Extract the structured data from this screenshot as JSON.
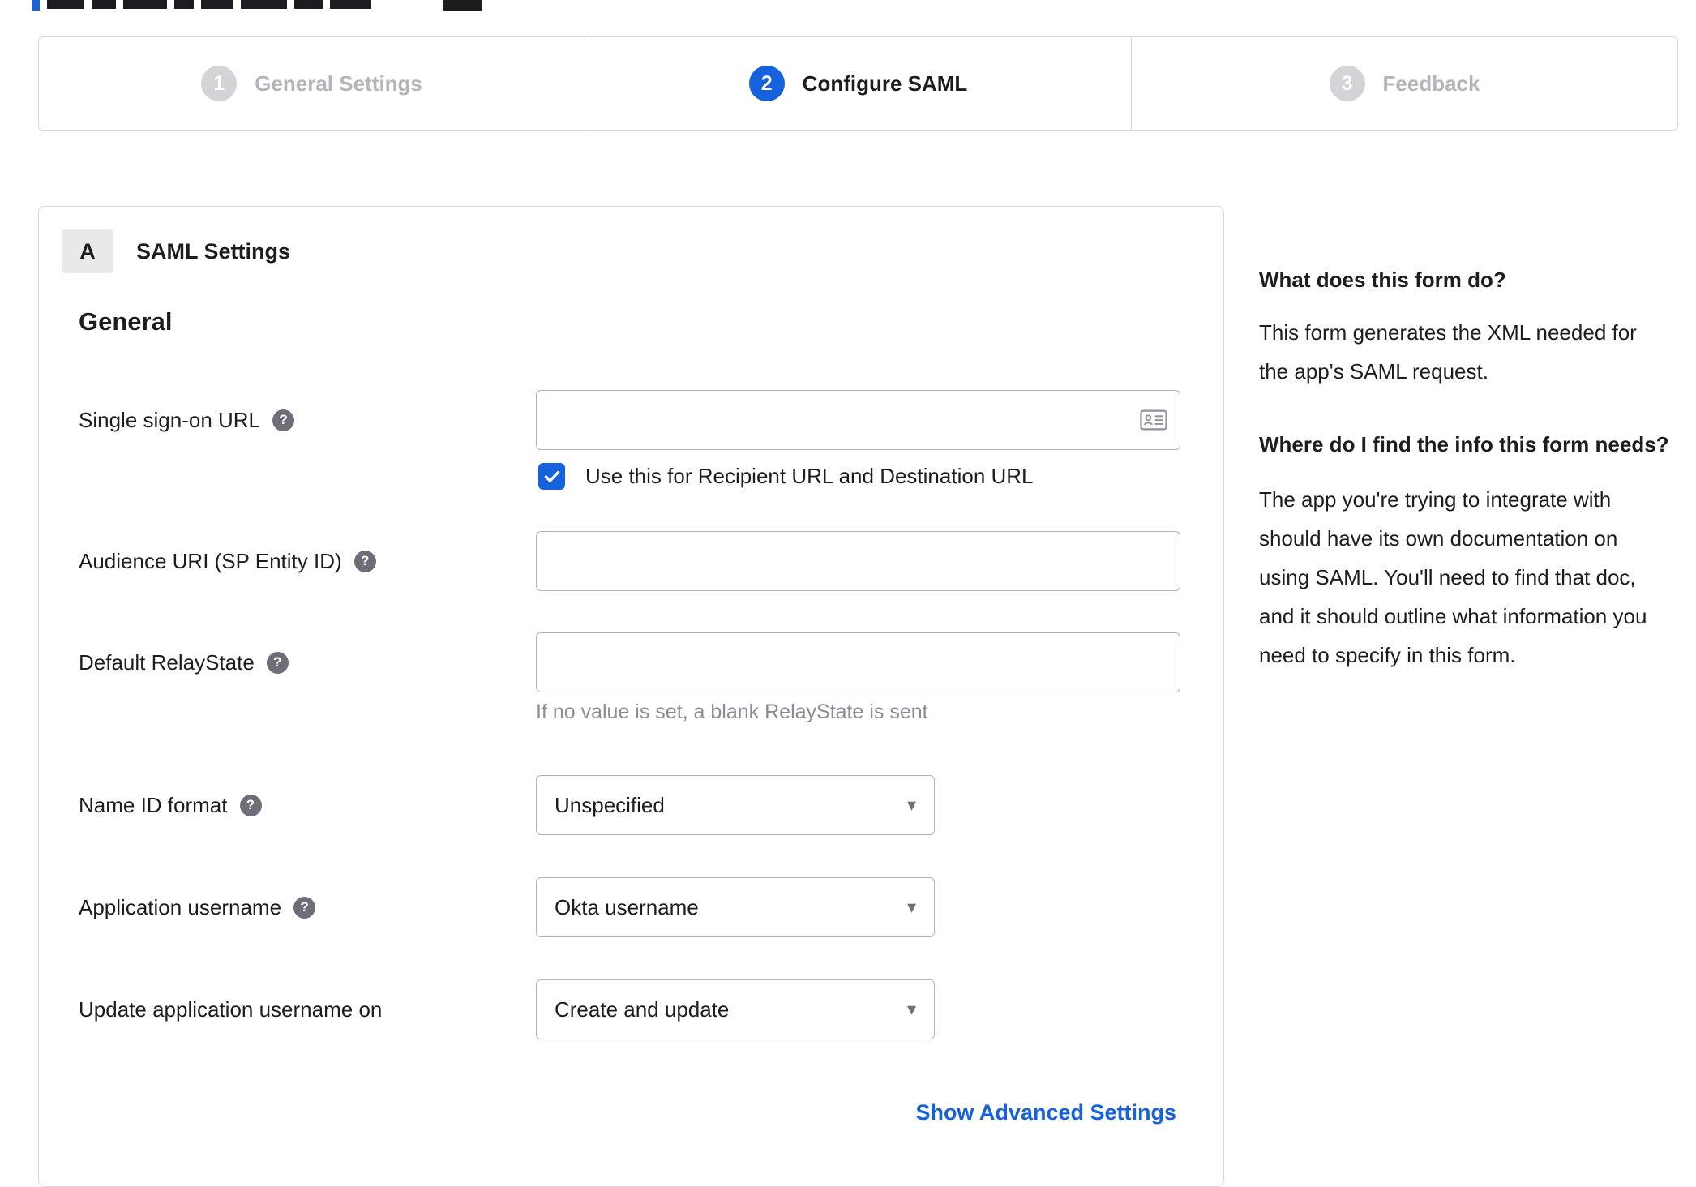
{
  "icons": {
    "help": "?",
    "dropdown": "▾"
  },
  "colors": {
    "accent": "#1662dd"
  },
  "stepper": {
    "active_step": "2",
    "steps": [
      {
        "number": "1",
        "label": "General Settings"
      },
      {
        "number": "2",
        "label": "Configure SAML"
      },
      {
        "number": "3",
        "label": "Feedback"
      }
    ]
  },
  "saml_card": {
    "badge": "A",
    "title": "SAML Settings",
    "group_heading": "General",
    "fields": [
      {
        "label": "Single sign-on URL",
        "value": "",
        "checkbox_checked": true,
        "checkbox_label": "Use this for Recipient URL and Destination URL"
      },
      {
        "label": "Audience URI (SP Entity ID)",
        "value": ""
      },
      {
        "label": "Default RelayState",
        "value": "",
        "hint": "If no value is set, a blank RelayState is sent"
      },
      {
        "label": "Name ID format",
        "value": "Unspecified"
      },
      {
        "label": "Application username",
        "value": "Okta username"
      },
      {
        "label": "Update application username on",
        "value": "Create and update"
      }
    ],
    "advanced_link": "Show Advanced Settings"
  },
  "sidebar": {
    "q1_title": "What does this form do?",
    "q1_body": "This form generates the XML needed for the app's SAML request.",
    "q2_title": "Where do I find the info this form needs?",
    "q2_body": "The app you're trying to integrate with should have its own documentation on using SAML. You'll need to find that doc, and it should outline what information you need to specify in this form."
  }
}
